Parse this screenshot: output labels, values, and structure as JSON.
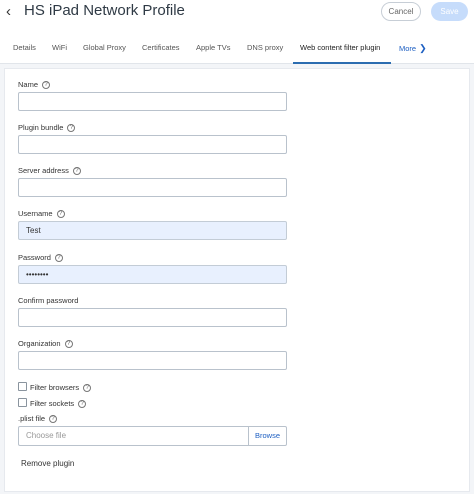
{
  "header": {
    "title": "HS iPad Network Profile",
    "cancel_label": "Cancel",
    "save_label": "Save"
  },
  "tabs": [
    {
      "label": "Details"
    },
    {
      "label": "WiFi"
    },
    {
      "label": "Global Proxy"
    },
    {
      "label": "Certificates"
    },
    {
      "label": "Apple TVs"
    },
    {
      "label": "DNS proxy"
    },
    {
      "label": "Web content filter plugin",
      "active": true
    },
    {
      "label": "More"
    }
  ],
  "form": {
    "name": {
      "label": "Name",
      "value": ""
    },
    "plugin_bundle": {
      "label": "Plugin bundle",
      "value": ""
    },
    "server_address": {
      "label": "Server address",
      "value": ""
    },
    "username": {
      "label": "Username",
      "value": "Test"
    },
    "password": {
      "label": "Password",
      "value": "••••••••"
    },
    "confirm_password": {
      "label": "Confirm password",
      "value": ""
    },
    "organization": {
      "label": "Organization",
      "value": ""
    },
    "filter_browsers": {
      "label": "Filter browsers",
      "checked": false
    },
    "filter_sockets": {
      "label": "Filter sockets",
      "checked": false
    },
    "plist_file": {
      "label": ".plist file",
      "placeholder": "Choose file",
      "browse_label": "Browse"
    },
    "remove_label": "Remove plugin"
  },
  "icons": {
    "back": "chevron-left-icon",
    "help": "question-circle-icon",
    "more": "chevron-right-icon"
  },
  "colors": {
    "accent": "#1d5fc2",
    "save_disabled": "#c6dcfb",
    "autofill": "#e8f0fe"
  }
}
